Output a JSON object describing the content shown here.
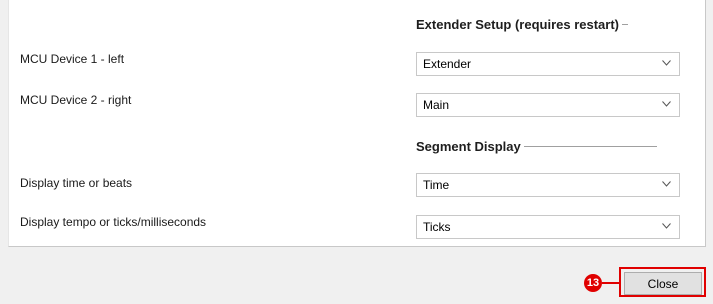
{
  "sections": [
    {
      "title": "Extender Setup (requires restart)"
    },
    {
      "title": "Segment Display"
    }
  ],
  "rows": [
    {
      "label": "MCU Device 1 - left",
      "value": "Extender"
    },
    {
      "label": "MCU Device 2 - right",
      "value": "Main"
    },
    {
      "label": "Display time or beats",
      "value": "Time"
    },
    {
      "label": "Display tempo or ticks/milliseconds",
      "value": "Ticks"
    }
  ],
  "footer": {
    "close_label": "Close",
    "step_number": "13"
  },
  "colors": {
    "highlight": "#e00000",
    "panel_bg": "#ffffff",
    "window_bg": "#f0f0f0"
  },
  "icons": {
    "dropdown": "chevron-down-icon"
  }
}
